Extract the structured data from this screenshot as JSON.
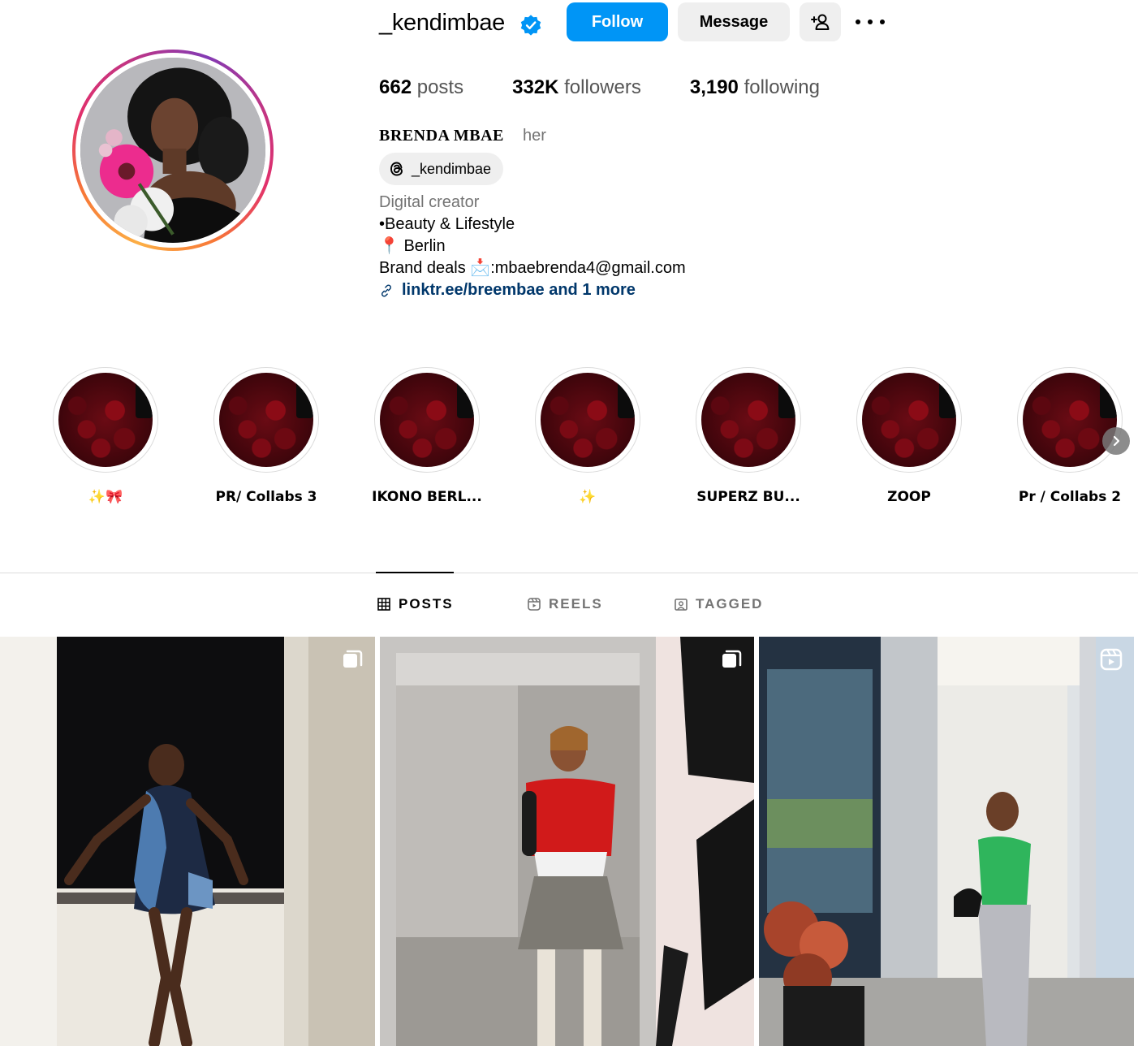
{
  "profile": {
    "username": "_kendimbae",
    "follow_label": "Follow",
    "message_label": "Message",
    "stats": {
      "posts_count": "662",
      "posts_label": "posts",
      "followers_count": "332K",
      "followers_label": "followers",
      "following_count": "3,190",
      "following_label": "following"
    },
    "full_name": "BRENDA MBAE",
    "pronouns": "her",
    "threads_handle": "_kendimbae",
    "bio": {
      "category": "Digital creator",
      "line1": "•Beauty & Lifestyle",
      "line2": "📍 Berlin",
      "line3": "Brand deals 📩:mbaebrenda4@gmail.com",
      "link": "linktr.ee/breembae and 1 more"
    }
  },
  "highlights": [
    {
      "label": "✨🎀"
    },
    {
      "label": "PR/ Collabs 3"
    },
    {
      "label": "IKONO BERL..."
    },
    {
      "label": "✨"
    },
    {
      "label": "SUPERZ BU..."
    },
    {
      "label": "ZOOP"
    },
    {
      "label": "Pr / Collabs 2"
    }
  ],
  "tabs": [
    {
      "label": "POSTS",
      "icon": "grid-icon",
      "active": true
    },
    {
      "label": "REELS",
      "icon": "reels-icon",
      "active": false
    },
    {
      "label": "TAGGED",
      "icon": "tagged-icon",
      "active": false
    }
  ],
  "posts": [
    {
      "type": "carousel",
      "badge_icon": "carousel-icon"
    },
    {
      "type": "carousel",
      "badge_icon": "carousel-icon"
    },
    {
      "type": "reel",
      "badge_icon": "reels-icon"
    }
  ],
  "colors": {
    "accent": "#0095f6",
    "link": "#00376b",
    "button_secondary": "#efefef",
    "muted_text": "#737373"
  }
}
